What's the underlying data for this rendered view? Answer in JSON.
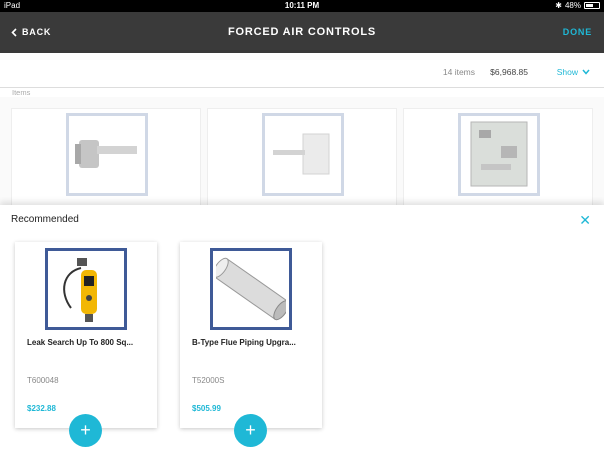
{
  "status": {
    "device": "iPad",
    "time": "10:11 PM",
    "battery_label": "48%",
    "battery_level": 0.48
  },
  "nav": {
    "back_label": "BACK",
    "title": "FORCED AIR CONTROLS",
    "done_label": "DONE"
  },
  "summary": {
    "count": "14 items",
    "total": "$6,968.85",
    "show_label": "Show"
  },
  "items": {
    "label": "Items"
  },
  "recommended": {
    "title": "Recommended",
    "products": [
      {
        "name": "Leak Search Up To 800 Sq...",
        "sku": "T600048",
        "price": "$232.88"
      },
      {
        "name": "B-Type Flue Piping Upgra...",
        "sku": "T52000S",
        "price": "$505.99"
      }
    ]
  },
  "colors": {
    "accent": "#1fb8d6",
    "navbar": "#3a3a3a",
    "thumb_border": "#3f5a97"
  }
}
